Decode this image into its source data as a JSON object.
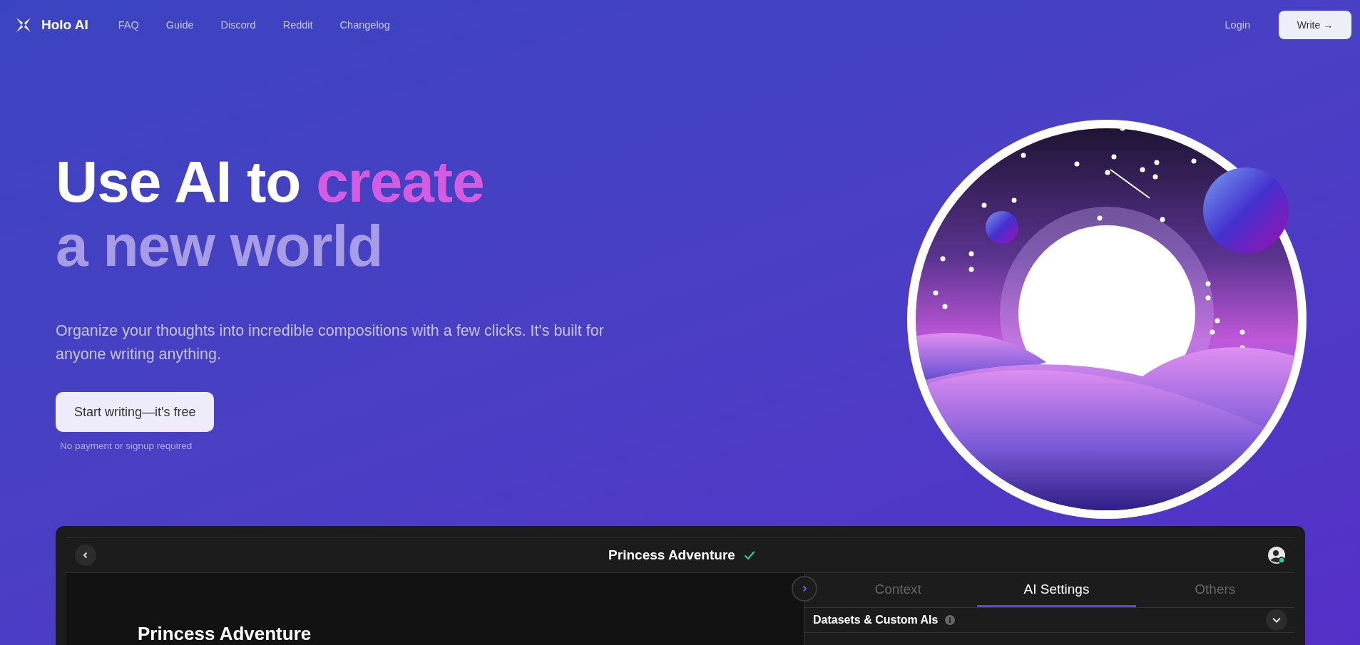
{
  "nav": {
    "brand": "Holo AI",
    "links": [
      "FAQ",
      "Guide",
      "Discord",
      "Reddit",
      "Changelog"
    ],
    "login": "Login",
    "write": "Write →"
  },
  "hero": {
    "headline": [
      {
        "text": "Use AI to ",
        "accent": false
      },
      {
        "text": "create",
        "accent": true
      }
    ],
    "subheadline": "a new world",
    "description": "Organize your thoughts into incredible compositions with a few clicks. It's built for anyone writing anything.",
    "cta": "Start writing—it's free",
    "note": "No payment or signup required"
  },
  "app_preview": {
    "title": "Princess Adventure",
    "saved": true,
    "doc_heading": "Princess Adventure",
    "tabs": [
      {
        "label": "Context",
        "selected": false
      },
      {
        "label": "AI Settings",
        "selected": true
      },
      {
        "label": "Others",
        "selected": false
      }
    ],
    "section": {
      "label": "Datasets & Custom AIs",
      "expanded": false
    }
  }
}
